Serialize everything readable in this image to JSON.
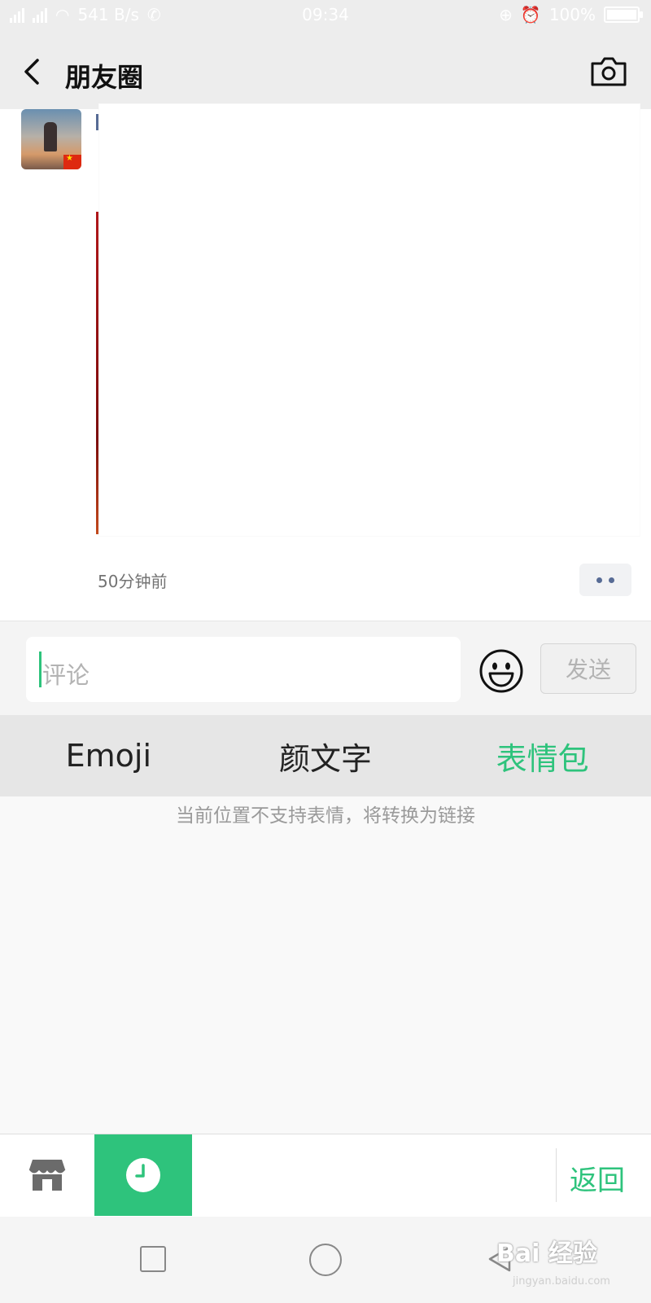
{
  "status_bar": {
    "network_speed": "541 B/s",
    "time": "09:34",
    "battery": "100%",
    "battery_level": 1.0
  },
  "header": {
    "title": "朋友圈"
  },
  "post": {
    "time_ago": "50分钟前"
  },
  "comment": {
    "placeholder": "评论",
    "send_label": "发送"
  },
  "tabs": [
    {
      "label": "Emoji",
      "active": false
    },
    {
      "label": "颜文字",
      "active": false
    },
    {
      "label": "表情包",
      "active": true
    }
  ],
  "panel": {
    "notice": "当前位置不支持表情，将转换为链接"
  },
  "toolbar": {
    "back_label": "返回"
  },
  "watermark": {
    "brand": "Bai 经验",
    "url": "jingyan.baidu.com"
  },
  "colors": {
    "accent": "#2ec37c",
    "link": "#576b95"
  }
}
